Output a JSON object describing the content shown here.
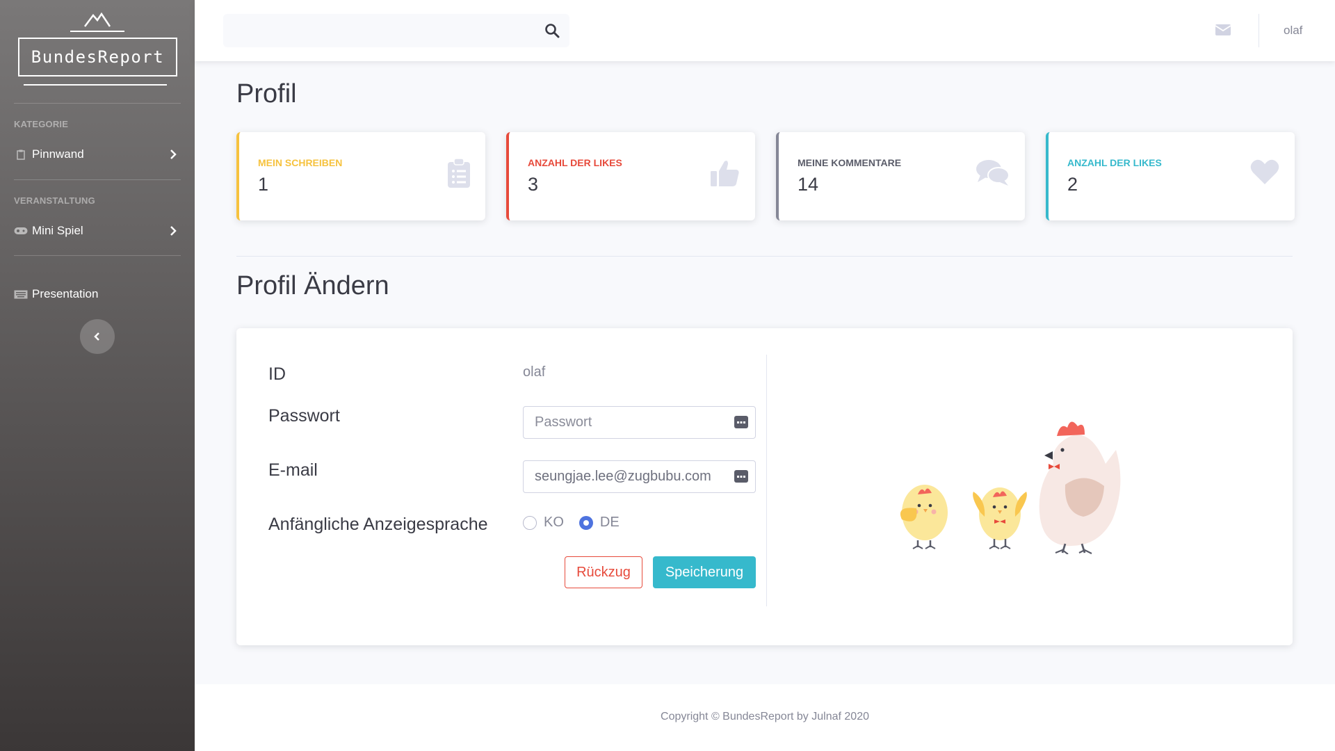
{
  "brand": {
    "name": "BundesReport"
  },
  "sidebar": {
    "sections": [
      {
        "heading": "KATEGORIE",
        "items": [
          {
            "label": "Pinnwand",
            "icon": "clipboard-icon"
          }
        ]
      },
      {
        "heading": "VERANSTALTUNG",
        "items": [
          {
            "label": "Mini Spiel",
            "icon": "gamepad-icon"
          }
        ]
      },
      {
        "heading": "",
        "items": [
          {
            "label": "Presentation",
            "icon": "keyboard-icon"
          }
        ]
      }
    ]
  },
  "topbar": {
    "search": {
      "placeholder": "",
      "value": ""
    },
    "user": "olaf"
  },
  "profile": {
    "title": "Profil",
    "cards": [
      {
        "label": "MEIN SCHREIBEN",
        "value": "1",
        "color": "#f6c23e",
        "icon": "clipboard-list-icon"
      },
      {
        "label": "ANZAHL DER LIKES",
        "value": "3",
        "color": "#e74a3b",
        "icon": "thumbs-up-icon"
      },
      {
        "label": "MEINE KOMMENTARE",
        "value": "14",
        "color": "#858796",
        "icon": "comments-icon"
      },
      {
        "label": "ANZAHL DER LIKES",
        "value": "2",
        "color": "#36b9cc",
        "icon": "heart-icon"
      }
    ]
  },
  "edit": {
    "title": "Profil Ändern",
    "id_label": "ID",
    "id_value": "olaf",
    "password_label": "Passwort",
    "password_placeholder": "Passwort",
    "email_label": "E-mail",
    "email_value": "seungjae.lee@zugbubu.com",
    "language_label": "Anfängliche Anzeigesprache",
    "languages": [
      {
        "code": "KO",
        "checked": false
      },
      {
        "code": "DE",
        "checked": true
      }
    ],
    "cancel_label": "Rückzug",
    "save_label": "Speicherung"
  },
  "footer": {
    "text": "Copyright © BundesReport by Julnaf 2020"
  },
  "colors": {
    "primary": "#4e73df",
    "info": "#36b9cc",
    "danger": "#e74a3b",
    "warning": "#f6c23e"
  }
}
